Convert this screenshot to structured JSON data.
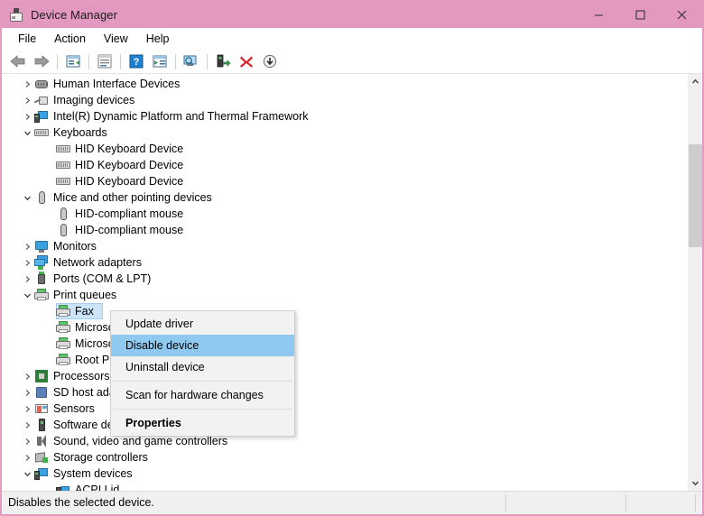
{
  "window": {
    "title": "Device Manager",
    "icon": "device-manager-icon",
    "titlebar_color": "#e298bf",
    "border_color": "#e49bc2",
    "controls": [
      {
        "name": "minimize",
        "glyph": "minimize-icon"
      },
      {
        "name": "maximize",
        "glyph": "maximize-icon"
      },
      {
        "name": "close",
        "glyph": "close-icon"
      }
    ]
  },
  "menubar": {
    "items": [
      {
        "label": "File"
      },
      {
        "label": "Action"
      },
      {
        "label": "View"
      },
      {
        "label": "Help"
      }
    ]
  },
  "toolbar": {
    "buttons": [
      {
        "name": "back-icon"
      },
      {
        "name": "forward-icon"
      },
      {
        "name": "separator"
      },
      {
        "name": "show-hide-console-tree-icon"
      },
      {
        "name": "separator"
      },
      {
        "name": "properties-icon"
      },
      {
        "name": "separator"
      },
      {
        "name": "help-icon"
      },
      {
        "name": "show-hide-action-pane-icon"
      },
      {
        "name": "separator"
      },
      {
        "name": "scan-for-hardware-changes-icon"
      },
      {
        "name": "separator"
      },
      {
        "name": "update-driver-icon"
      },
      {
        "name": "uninstall-device-icon"
      },
      {
        "name": "disable-device-icon"
      }
    ]
  },
  "tree": {
    "items": [
      {
        "label": "Human Interface Devices",
        "indent": 0,
        "twisty": "collapsed",
        "icon": "hid-icon"
      },
      {
        "label": "Imaging devices",
        "indent": 0,
        "twisty": "collapsed",
        "icon": "imaging-icon"
      },
      {
        "label": "Intel(R) Dynamic Platform and Thermal Framework",
        "indent": 0,
        "twisty": "collapsed",
        "icon": "system-device-icon"
      },
      {
        "label": "Keyboards",
        "indent": 0,
        "twisty": "expanded",
        "icon": "keyboard-icon"
      },
      {
        "label": "HID Keyboard Device",
        "indent": 1,
        "twisty": "none",
        "icon": "keyboard-icon"
      },
      {
        "label": "HID Keyboard Device",
        "indent": 1,
        "twisty": "none",
        "icon": "keyboard-icon"
      },
      {
        "label": "HID Keyboard Device",
        "indent": 1,
        "twisty": "none",
        "icon": "keyboard-icon"
      },
      {
        "label": "Mice and other pointing devices",
        "indent": 0,
        "twisty": "expanded",
        "icon": "mouse-icon"
      },
      {
        "label": "HID-compliant mouse",
        "indent": 1,
        "twisty": "none",
        "icon": "mouse-icon"
      },
      {
        "label": "HID-compliant mouse",
        "indent": 1,
        "twisty": "none",
        "icon": "mouse-icon"
      },
      {
        "label": "Monitors",
        "indent": 0,
        "twisty": "collapsed",
        "icon": "monitor-icon"
      },
      {
        "label": "Network adapters",
        "indent": 0,
        "twisty": "collapsed",
        "icon": "network-adapter-icon"
      },
      {
        "label": "Ports (COM & LPT)",
        "indent": 0,
        "twisty": "collapsed",
        "icon": "port-icon"
      },
      {
        "label": "Print queues",
        "indent": 0,
        "twisty": "expanded",
        "icon": "printer-icon"
      },
      {
        "label": "Fax",
        "indent": 1,
        "twisty": "none",
        "icon": "printer-icon",
        "selected": true
      },
      {
        "label": "Microsoft Print to PDF",
        "indent": 1,
        "twisty": "none",
        "icon": "printer-icon"
      },
      {
        "label": "Microsoft XPS Document Writer",
        "indent": 1,
        "twisty": "none",
        "icon": "printer-icon"
      },
      {
        "label": "Root Print Queue",
        "indent": 1,
        "twisty": "none",
        "icon": "printer-icon"
      },
      {
        "label": "Processors",
        "indent": 0,
        "twisty": "collapsed",
        "icon": "processor-icon"
      },
      {
        "label": "SD host adapters",
        "indent": 0,
        "twisty": "collapsed",
        "icon": "sd-host-icon"
      },
      {
        "label": "Sensors",
        "indent": 0,
        "twisty": "collapsed",
        "icon": "sensor-icon"
      },
      {
        "label": "Software devices",
        "indent": 0,
        "twisty": "collapsed",
        "icon": "software-device-icon"
      },
      {
        "label": "Sound, video and game controllers",
        "indent": 0,
        "twisty": "collapsed",
        "icon": "sound-icon"
      },
      {
        "label": "Storage controllers",
        "indent": 0,
        "twisty": "collapsed",
        "icon": "storage-controller-icon"
      },
      {
        "label": "System devices",
        "indent": 0,
        "twisty": "expanded",
        "icon": "system-device-icon"
      },
      {
        "label": "ACPI Lid",
        "indent": 1,
        "twisty": "none",
        "icon": "acpi-icon"
      }
    ]
  },
  "context_menu": {
    "highlight_color": "#8fc9f0",
    "items": [
      {
        "label": "Update driver",
        "state": "normal"
      },
      {
        "label": "Disable device",
        "state": "highlighted"
      },
      {
        "label": "Uninstall device",
        "state": "normal"
      },
      {
        "type": "separator"
      },
      {
        "label": "Scan for hardware changes",
        "state": "normal"
      },
      {
        "type": "separator"
      },
      {
        "label": "Properties",
        "state": "bold"
      }
    ]
  },
  "statusbar": {
    "text": "Disables the selected device."
  },
  "scrollbar": {
    "up_arrow": "chevron-up-icon",
    "down_arrow": "chevron-down-icon"
  }
}
